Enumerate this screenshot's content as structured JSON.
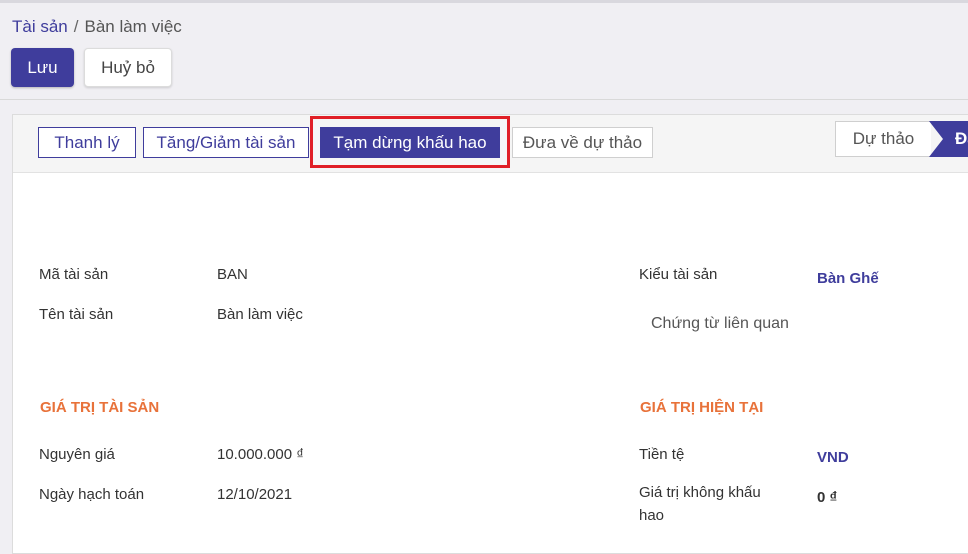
{
  "breadcrumb": {
    "parent": "Tài sản",
    "separator": "/",
    "current": "Bàn làm việc"
  },
  "toolbar": {
    "save_label": "Lưu",
    "cancel_label": "Huỷ bỏ"
  },
  "statusbar": {
    "buttons": {
      "liquidate": "Thanh lý",
      "adjust": "Tăng/Giảm tài sản",
      "pause": "Tạm dừng khấu hao",
      "draft": "Đưa về dự thảo"
    },
    "stages": {
      "draft": "Dự thảo",
      "active": "Đa"
    }
  },
  "form": {
    "code_label": "Mã tài sản",
    "code_value": "BAN",
    "name_label": "Tên tài sản",
    "name_value": "Bàn làm việc",
    "type_label": "Kiểu tài sản",
    "type_value": "Bàn Ghế",
    "related_docs": "Chứng từ liên quan",
    "asset_value_title": "GIÁ TRỊ TÀI SẢN",
    "original_price_label": "Nguyên giá",
    "original_price_value": "10.000.000 ₫",
    "accounting_date_label": "Ngày hạch toán",
    "accounting_date_value": "12/10/2021",
    "current_value_title": "GIÁ TRỊ HIỆN TẠI",
    "currency_label": "Tiền tệ",
    "currency_value": "VND",
    "non_depreciable_label_1": "Giá trị không khấu",
    "non_depreciable_label_2": "hao",
    "non_depreciable_value": "0 ₫"
  },
  "colors": {
    "primary": "#3f3d9c",
    "accent": "#e8723a",
    "highlight": "#e01f26"
  }
}
